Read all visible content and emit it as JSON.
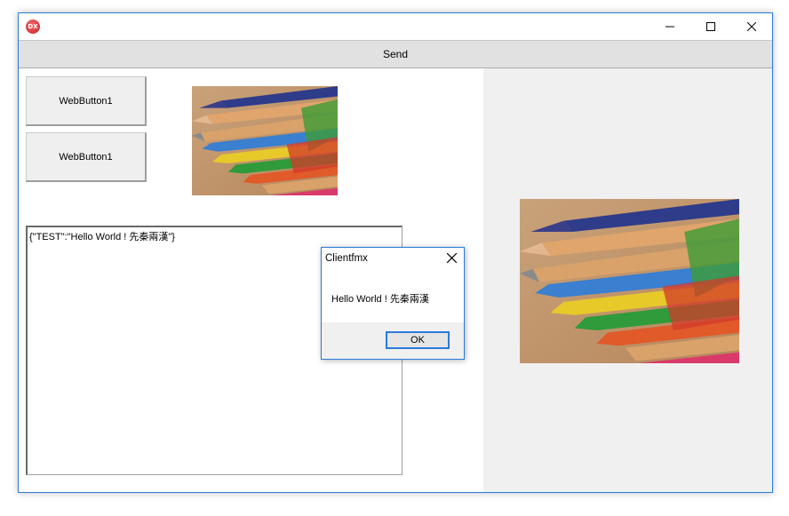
{
  "window": {
    "app_icon": "dx-logo-icon",
    "app_icon_text": "DX",
    "controls": [
      "minimize-icon",
      "maximize-icon",
      "close-icon"
    ]
  },
  "toolbar": {
    "send_label": "Send"
  },
  "left_panel": {
    "buttons": [
      {
        "label": "WebButton1"
      },
      {
        "label": "WebButton1"
      }
    ],
    "image_icon": "colored-pencils-image",
    "memo_text": "{\"TEST\":\"Hello World ! 先秦兩漢\"}"
  },
  "right_panel": {
    "image_icon": "colored-pencils-image"
  },
  "dialog": {
    "title": "Clientfmx",
    "message": "Hello World ! 先秦兩漢",
    "ok_label": "OK",
    "accent": "#2b7bd8"
  }
}
